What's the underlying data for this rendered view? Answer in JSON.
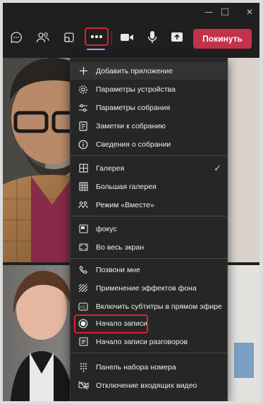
{
  "window": {
    "minimize": "—",
    "maximize": "□",
    "close": "✕"
  },
  "toolbar": {
    "icons": [
      "chat-icon",
      "participants-icon",
      "rooms-icon",
      "more-icon",
      "camera-icon",
      "mic-icon",
      "share-icon"
    ],
    "leave_label": "Покинуть",
    "leave_color": "#c4314b",
    "accent_color": "#9ea2ff",
    "highlight_color": "#e0202d"
  },
  "menu": {
    "items": [
      {
        "label": "Добавить приложение",
        "icon": "plus-icon"
      },
      {
        "label": "Параметры устройства",
        "icon": "gear-icon"
      },
      {
        "label": "Параметры собрания",
        "icon": "sliders-icon"
      },
      {
        "label": "Заметки к собранию",
        "icon": "notes-icon"
      },
      {
        "label": "Сведения о собрании",
        "icon": "info-icon"
      },
      {
        "label": "Галерея",
        "icon": "gallery-icon",
        "checked": "✓"
      },
      {
        "label": "Большая галерея",
        "icon": "large-gallery-icon"
      },
      {
        "label": "Режим «Вместе»",
        "icon": "together-mode-icon"
      },
      {
        "label": "фокус",
        "icon": "focus-icon"
      },
      {
        "label": "Во весь экран",
        "icon": "fullscreen-icon"
      },
      {
        "label": "Позвони мне",
        "icon": "phone-icon"
      },
      {
        "label": "Применение эффектов фона",
        "icon": "background-effects-icon"
      },
      {
        "label": "Включить субтитры в прямом эфире",
        "icon": "captions-icon"
      },
      {
        "label": "Начало записи",
        "icon": "record-icon"
      },
      {
        "label": "Начало записи разговоров",
        "icon": "transcript-icon"
      },
      {
        "label": "Панель набора номера",
        "icon": "dialpad-icon"
      },
      {
        "label": "Отключение входящих видео",
        "icon": "video-off-icon"
      }
    ]
  }
}
